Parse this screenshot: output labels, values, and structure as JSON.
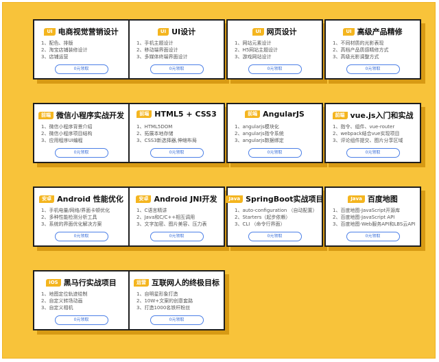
{
  "courses": [
    {
      "tag": "UI",
      "title": "电商视觉营销设计",
      "items": [
        "1、配色、排版",
        "2、淘宝店铺装修设计",
        "3、店铺运营"
      ],
      "button": "0元领取"
    },
    {
      "tag": "UI",
      "title": "UI设计",
      "items": [
        "1、手机主题设计",
        "2、移动端界面设计",
        "3、多媒体终端界面设计"
      ],
      "button": "0元领取"
    },
    {
      "tag": "UI",
      "title": "网页设计",
      "items": [
        "1、网站元素设计",
        "2、H5网站主题设计",
        "3、游戏网站设计"
      ],
      "button": "0元领取"
    },
    {
      "tag": "UI",
      "title": "高级产品精修",
      "items": [
        "1、不同材质的光影表现",
        "2、高档产品质感精修方式",
        "3、高级光影调整方式"
      ],
      "button": "0元领取"
    },
    {
      "tag": "前端",
      "title": "微信小程序实战开发",
      "items": [
        "1、微信小程序背景介绍",
        "2、微信小程序项目结构",
        "3、应用程序UI编程"
      ],
      "button": "0元领取"
    },
    {
      "tag": "前端",
      "title": "HTML5 + CSS3",
      "items": [
        "1、HTML5DOM",
        "2、拓展本地存储",
        "3、CSS3新选择器,伸缩布局"
      ],
      "button": "0元领取"
    },
    {
      "tag": "前端",
      "title": "AngularJS",
      "items": [
        "1、angularjs模块化",
        "2、angularjs指令系统",
        "3、angularjs数据绑定"
      ],
      "button": "0元领取"
    },
    {
      "tag": "前端",
      "title": "vue.js入门和实战",
      "items": [
        "1、指令、组件、vue-router",
        "2、webpack结合vue实现项目",
        "3、评论组件提交、图片分享区域"
      ],
      "button": "0元领取"
    },
    {
      "tag": "安卓",
      "title": "Android 性能优化",
      "items": [
        "1、手机电量/网络/界面卡顿优化",
        "2、多种性能检测分析工具",
        "3、系统的界面优化解决方案"
      ],
      "button": "0元领取"
    },
    {
      "tag": "安卓",
      "title": "Android JNI开发",
      "items": [
        "1、C语言精讲",
        "2、Java和C/C++相互调用",
        "3、文字加密、图片美容、压力表"
      ],
      "button": "0元领取"
    },
    {
      "tag": "Java",
      "title": "SpringBoot实战项目",
      "items": [
        "1、auto-configuration （自动配置）",
        "2、Starters（起步依赖）",
        "3、CLI （命令行界面）"
      ],
      "button": "0元领取"
    },
    {
      "tag": "Java",
      "title": "百度地图",
      "items": [
        "1、百度地图-JavaScript开源库",
        "2、百度地图-JavaScript API",
        "3、百度地图-Web服务API和LBS云API"
      ],
      "button": "0元领取"
    },
    {
      "tag": "iOS",
      "title": "黑马行实战项目",
      "items": [
        "1、地图定位轨迹绘制",
        "2、自定义转场动画",
        "3、自定义相机"
      ],
      "button": "0元领取"
    },
    {
      "tag": "运营",
      "title": "互联网人的终极目标",
      "items": [
        "1、自明星形象打造",
        "2、10W+文案的创意套路",
        "3、打造1000名铁杆粉丝"
      ],
      "button": "0元领取"
    }
  ]
}
